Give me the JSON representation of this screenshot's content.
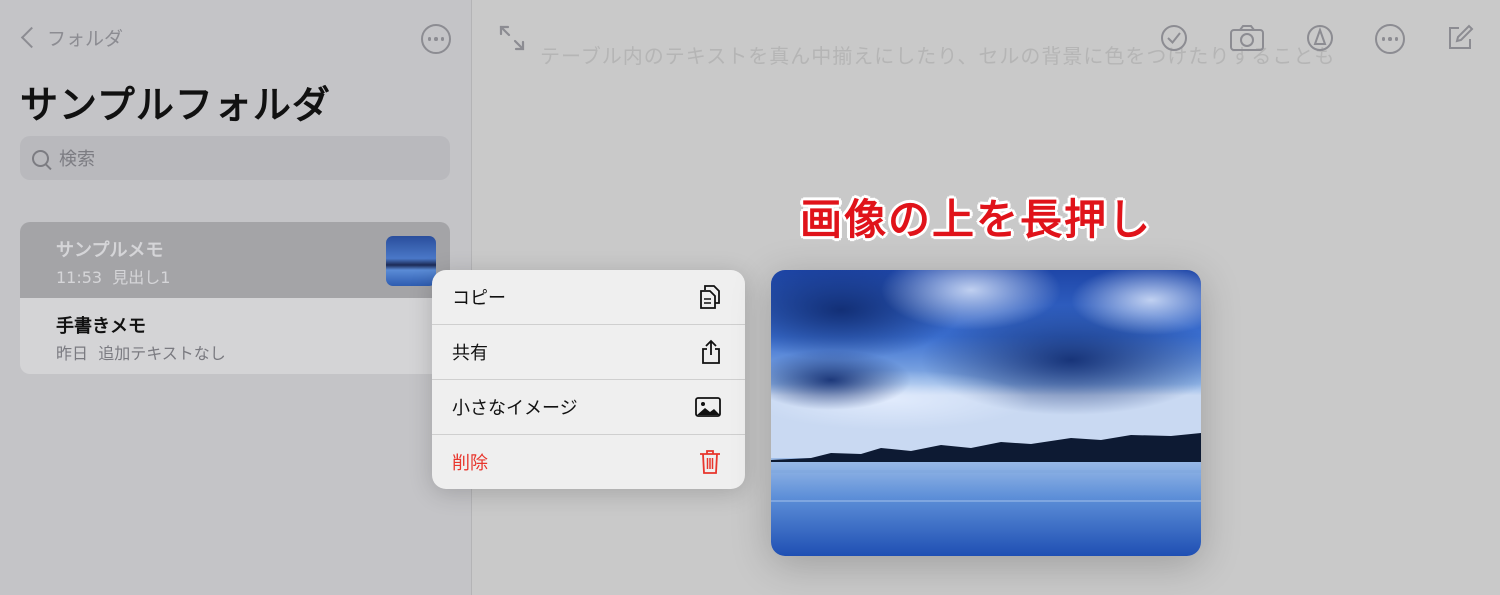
{
  "sidebar": {
    "back_label": "フォルダ",
    "folder_title": "サンプルフォルダ",
    "search_placeholder": "検索",
    "notes": [
      {
        "title": "サンプルメモ",
        "time": "11:53",
        "subtitle": "見出し1"
      },
      {
        "title": "手書きメモ",
        "time": "昨日",
        "subtitle": "追加テキストなし"
      }
    ]
  },
  "editor": {
    "background_text": "テーブル内のテキストを真ん中揃えにしたり、セルの背景に色をつけたりすることも"
  },
  "annotation": "画像の上を長押し",
  "context_menu": {
    "items": [
      {
        "label": "コピー",
        "icon": "copy-icon"
      },
      {
        "label": "共有",
        "icon": "share-icon"
      },
      {
        "label": "小さなイメージ",
        "icon": "image-icon"
      },
      {
        "label": "削除",
        "icon": "trash-icon"
      }
    ]
  },
  "colors": {
    "accent": "#e0131a",
    "danger": "#e8352c",
    "icon_gray": "#8c8c92"
  }
}
